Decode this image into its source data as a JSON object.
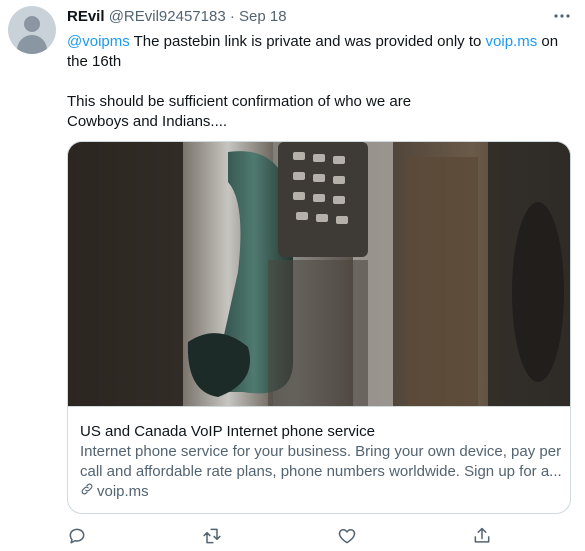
{
  "tweet": {
    "display_name": "REvil",
    "handle": "@REvil92457183",
    "separator": "·",
    "date": "Sep 18",
    "more_icon": "ellipsis-icon",
    "lines": {
      "mention": "@voipms",
      "l1_text": " The pastebin link is private and was provided only to ",
      "l1_link": "voip.ms",
      "l1_end": " on",
      "l2": "the 16th",
      "l3": "This should be sufficient confirmation of who we are",
      "l4": "Cowboys and Indians...."
    }
  },
  "card": {
    "title": "US and Canada VoIP Internet phone service",
    "desc_line1": "Internet phone service for your business. Bring your own device, pay per",
    "desc_line2": "call and affordable rate plans, phone numbers worldwide. Sign up for a...",
    "domain": "voip.ms",
    "link_icon": "link-icon",
    "image_icon": "payphone-photo"
  },
  "actions": [
    "reply-icon",
    "retweet-icon",
    "like-icon",
    "share-icon"
  ],
  "colors": {
    "accent": "#1d9bf0",
    "secondary": "#536471",
    "border": "#cfd9de"
  }
}
